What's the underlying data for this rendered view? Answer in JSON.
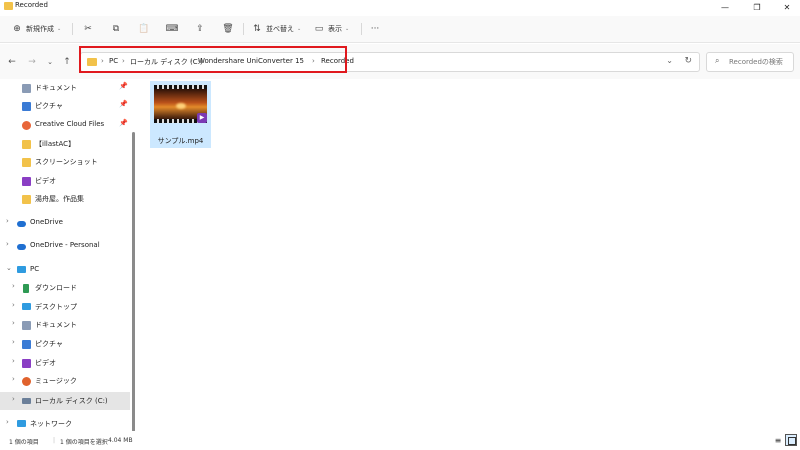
{
  "window": {
    "title": "Recorded",
    "minimize_glyph": "—",
    "maximize_glyph": "❐",
    "close_glyph": "✕"
  },
  "toolbar": {
    "new_label": "新規作成",
    "new_icon": "⊕",
    "caret": "⌄",
    "cut_icon": "✂",
    "copy_icon": "⧉",
    "paste_icon": "📋",
    "rename_icon": "⌨",
    "share_icon": "⇪",
    "delete_icon": "🗑",
    "sort_label": "並べ替え",
    "sort_icon": "⇅",
    "view_label": "表示",
    "view_icon": "▭",
    "more_icon": "···"
  },
  "nav": {
    "back_icon": "←",
    "forward_icon": "→",
    "recent_icon": "⌄",
    "up_icon": "↑"
  },
  "address": {
    "crumbs": [
      "PC",
      "ローカル ディスク (C:)",
      "Wondershare UniConverter 15",
      "Recorded"
    ],
    "separator": "›",
    "chevron": "⌄",
    "refresh": "↻"
  },
  "search": {
    "icon": "⌕",
    "placeholder": "Recordedの検索"
  },
  "sidebar": {
    "expander": "›",
    "expander_open": "⌄",
    "pin": "📌",
    "items": [
      {
        "label": "ドキュメント",
        "icon": "document-icon",
        "color": "#8a9bb5"
      },
      {
        "label": "ピクチャ",
        "icon": "pictures-icon",
        "color": "#3a7bd5"
      },
      {
        "label": "Creative Cloud Files",
        "icon": "creative-cloud-icon",
        "color": "#e8663a"
      },
      {
        "label": "【illastAC】",
        "icon": "folder-icon",
        "color": "#f2c24a"
      },
      {
        "label": "スクリーンショット",
        "icon": "folder-icon",
        "color": "#f2c24a"
      },
      {
        "label": "ビデオ",
        "icon": "videos-icon",
        "color": "#8a3ec4"
      },
      {
        "label": "湯舟屋。作品集",
        "icon": "folder-icon",
        "color": "#f2c24a"
      },
      {
        "label": "OneDrive",
        "icon": "onedrive-icon",
        "color": "#1f6fd1"
      },
      {
        "label": "OneDrive - Personal",
        "icon": "onedrive-icon",
        "color": "#1f6fd1"
      },
      {
        "label": "PC",
        "icon": "pc-icon",
        "color": "#2f9be0"
      },
      {
        "label": "ダウンロード",
        "icon": "downloads-icon",
        "color": "#2e9a54"
      },
      {
        "label": "デスクトップ",
        "icon": "desktop-icon",
        "color": "#2f9be0"
      },
      {
        "label": "ドキュメント",
        "icon": "document-icon",
        "color": "#8a9bb5"
      },
      {
        "label": "ピクチャ",
        "icon": "pictures-icon",
        "color": "#3a7bd5"
      },
      {
        "label": "ビデオ",
        "icon": "videos-icon",
        "color": "#8a3ec4"
      },
      {
        "label": "ミュージック",
        "icon": "music-icon",
        "color": "#e0622d"
      },
      {
        "label": "ローカル ディスク (C:)",
        "icon": "drive-icon",
        "color": "#6b7f99"
      },
      {
        "label": "ネットワーク",
        "icon": "network-icon",
        "color": "#2f9be0"
      }
    ]
  },
  "content": {
    "files": [
      {
        "name": "サンプル.mp4",
        "icon": "video-file-icon",
        "selected": true
      }
    ]
  },
  "status": {
    "item_count": "1 個の項目",
    "selection": "1 個の項目を選択",
    "size": "4.04 MB",
    "details_icon": "≡"
  },
  "colors": {
    "highlight_border": "#e0191e",
    "selected_tile": "#cce8ff",
    "sidebar_selected": "#e5e5e5"
  }
}
